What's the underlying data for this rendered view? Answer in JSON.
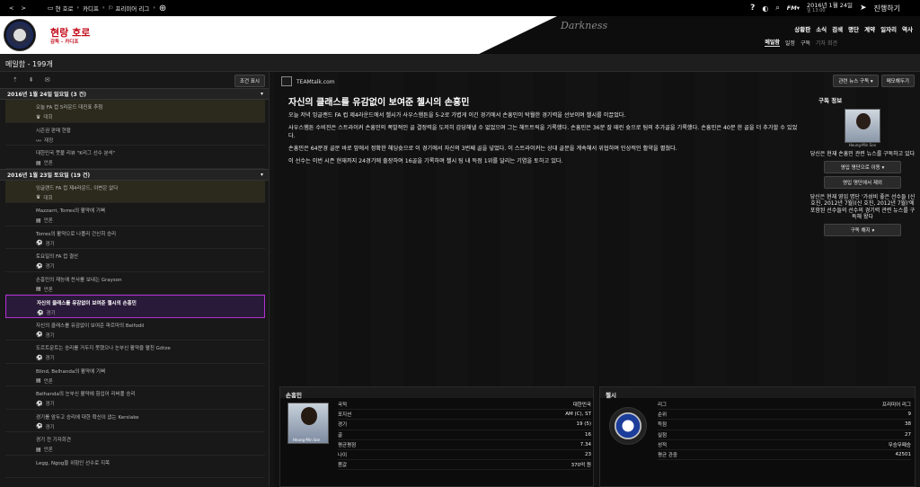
{
  "topbar": {
    "back": "<",
    "forward": ">",
    "home_label": "현 호로",
    "club_label": "카디프",
    "league_label": "프리미어 리그",
    "help": "?",
    "date": "2016년 1월 24일",
    "time": "일 13:00",
    "continue_label": "진행하기"
  },
  "header": {
    "club_title": "현랑 호로",
    "club_sub": "감독 - 카디프",
    "skin_name": "Darkness",
    "nav": [
      "상황판",
      "소식",
      "검색",
      "명단",
      "계약",
      "일자리",
      "역사"
    ],
    "subnav": [
      "메일함",
      "일정",
      "구독",
      "기자 회견"
    ]
  },
  "page_title": "메일함 - 199개",
  "inbox": {
    "filter_label": "조건 표시",
    "groups": [
      {
        "title": "2016년 1월 24일 일요일 (3 건)",
        "messages": [
          {
            "subject": "오늘 FA 컵 5라운드 대진표 추첨",
            "category": "대회",
            "icon": "trophy-icon",
            "unread": true
          },
          {
            "subject": "시즌권 판매 현황",
            "category": "재정",
            "icon": "finance-icon",
            "unread": false
          },
          {
            "subject": "대한민국 풋볼 리뷰 \"K리그 선수 분석\"",
            "category": "언론",
            "icon": "news-icon",
            "unread": false
          }
        ]
      },
      {
        "title": "2016년 1월 23일 토요일 (19 건)",
        "messages": [
          {
            "subject": "잉글랜드 FA 컵 제4라운드, 이변은 없다",
            "category": "대회",
            "icon": "trophy-icon",
            "unread": true
          },
          {
            "subject": "Mazzarri, Torres의 활약에 기뻐",
            "category": "언론",
            "icon": "news-icon",
            "unread": false
          },
          {
            "subject": "Torres의 활약으로 나폴리 간신히 승리",
            "category": "경기",
            "icon": "ball-icon",
            "unread": false
          },
          {
            "subject": "토요일의 FA 컵 결산",
            "category": "경기",
            "icon": "ball-icon",
            "unread": false
          },
          {
            "subject": "손흥민의 재능에 찬사를 보내는 Grayson",
            "category": "언론",
            "icon": "news-icon",
            "unread": false
          },
          {
            "subject": "자신의 클래스를 유감없이 보여준 첼시의 손흥민",
            "category": "경기",
            "icon": "ball-icon",
            "unread": false,
            "selected": true
          },
          {
            "subject": "자신의 클래스를 유감없이 보여준 파르마의 Belfodil",
            "category": "경기",
            "icon": "ball-icon",
            "unread": false
          },
          {
            "subject": "도르트문트는 승리를 거두지 못했으나 눈부신 활약을 펼친 Götze",
            "category": "경기",
            "icon": "ball-icon",
            "unread": false
          },
          {
            "subject": "Blind, Belhanda의 활약에 기뻐",
            "category": "언론",
            "icon": "news-icon",
            "unread": false
          },
          {
            "subject": "Belhanda의 눈부신 활약에 힘입어 리버풀 승리",
            "category": "경기",
            "icon": "ball-icon",
            "unread": false
          },
          {
            "subject": "경기를 앞두고 승리에 대한 확신이 없는 Kerslake",
            "category": "경기",
            "icon": "ball-icon",
            "unread": false
          },
          {
            "subject": "경기 전 기자회견",
            "category": "언론",
            "icon": "news-icon",
            "unread": false
          },
          {
            "subject": "Legg, Ngog을 위험인 선수로 지목",
            "category": "",
            "icon": "",
            "unread": false
          }
        ]
      }
    ]
  },
  "article": {
    "source": "TEAMtalk.com",
    "related_button": "관련 뉴스 구독 ▾",
    "reply_button": "메모해두기",
    "headline": "자신의 클래스를 유감없이 보여준 첼시의 손흥민",
    "paragraphs": [
      "오늘 저녁 잉글랜드 FA 컵 제4라운드에서 첼시가 사우스햄튼을 5-2로 가볍게 이긴 경기에서 손흥민이 탁월한 경기력을 선보이며 첼시를 이끌었다.",
      "사우스햄튼 수비진은 스트라이커 손흥민의 폭발적인 골 결정력을 도저히 감당해낼 수 없었으며 그는 해트트릭을 기록했다. 손흥민은 36분 잘 때린 슛으로 팀의 추가골을 기록했다. 손흥민은 40분 한 골을 더 추가할 수 있었다.",
      "손흥민은 64분경 골문 바로 앞에서 정확한 헤딩슛으로 이 경기에서 자신의 3번째 골을 넣었다. 이 스트라이커는 상대 골문을 계속해서 위협하며 인상적인 활약을 펼쳤다.",
      "이 선수는 이번 시즌 현재까지 24경기에 출장하여 16골을 기록하며 첼시 팀 내 득점 1위를 달리는 기염을 토하고 있다."
    ]
  },
  "follow": {
    "title": "구독 정보",
    "photo_caption": "Heung-Min Son",
    "text1": "당신은 현재 손흥민 관련 뉴스를 구독하고 있다",
    "btn1": "영입 명단으로 이동",
    "btn2": "영입 명단에서 제외",
    "text2": "당신은 현재 영입 명단 '가성비 좋은 선수들 (신 호진, 2012년 7월)(신 호진, 2012년 7월)'에 포함된 선수들의 선수의 경기력 관련 뉴스를 구독해 왔다",
    "btn3": "구독 해지"
  },
  "player_panel": {
    "title": "손흥민",
    "photo_caption": "Heung-Min Son",
    "rows": [
      {
        "k": "국적",
        "v": "대한민국"
      },
      {
        "k": "포지션",
        "v": "AM (C), ST"
      },
      {
        "k": "경기",
        "v": "19 (5)"
      },
      {
        "k": "골",
        "v": "16"
      },
      {
        "k": "평균평점",
        "v": "7.34"
      },
      {
        "k": "나이",
        "v": "23"
      },
      {
        "k": "몸값",
        "v": "370억 원"
      }
    ]
  },
  "club_panel": {
    "title": "첼시",
    "rows": [
      {
        "k": "리그",
        "v": "프리미어 리그"
      },
      {
        "k": "순위",
        "v": "9"
      },
      {
        "k": "득점",
        "v": "38"
      },
      {
        "k": "실점",
        "v": "27"
      },
      {
        "k": "성적",
        "v": "무승무패승"
      },
      {
        "k": "평균 관중",
        "v": "42501"
      }
    ]
  }
}
